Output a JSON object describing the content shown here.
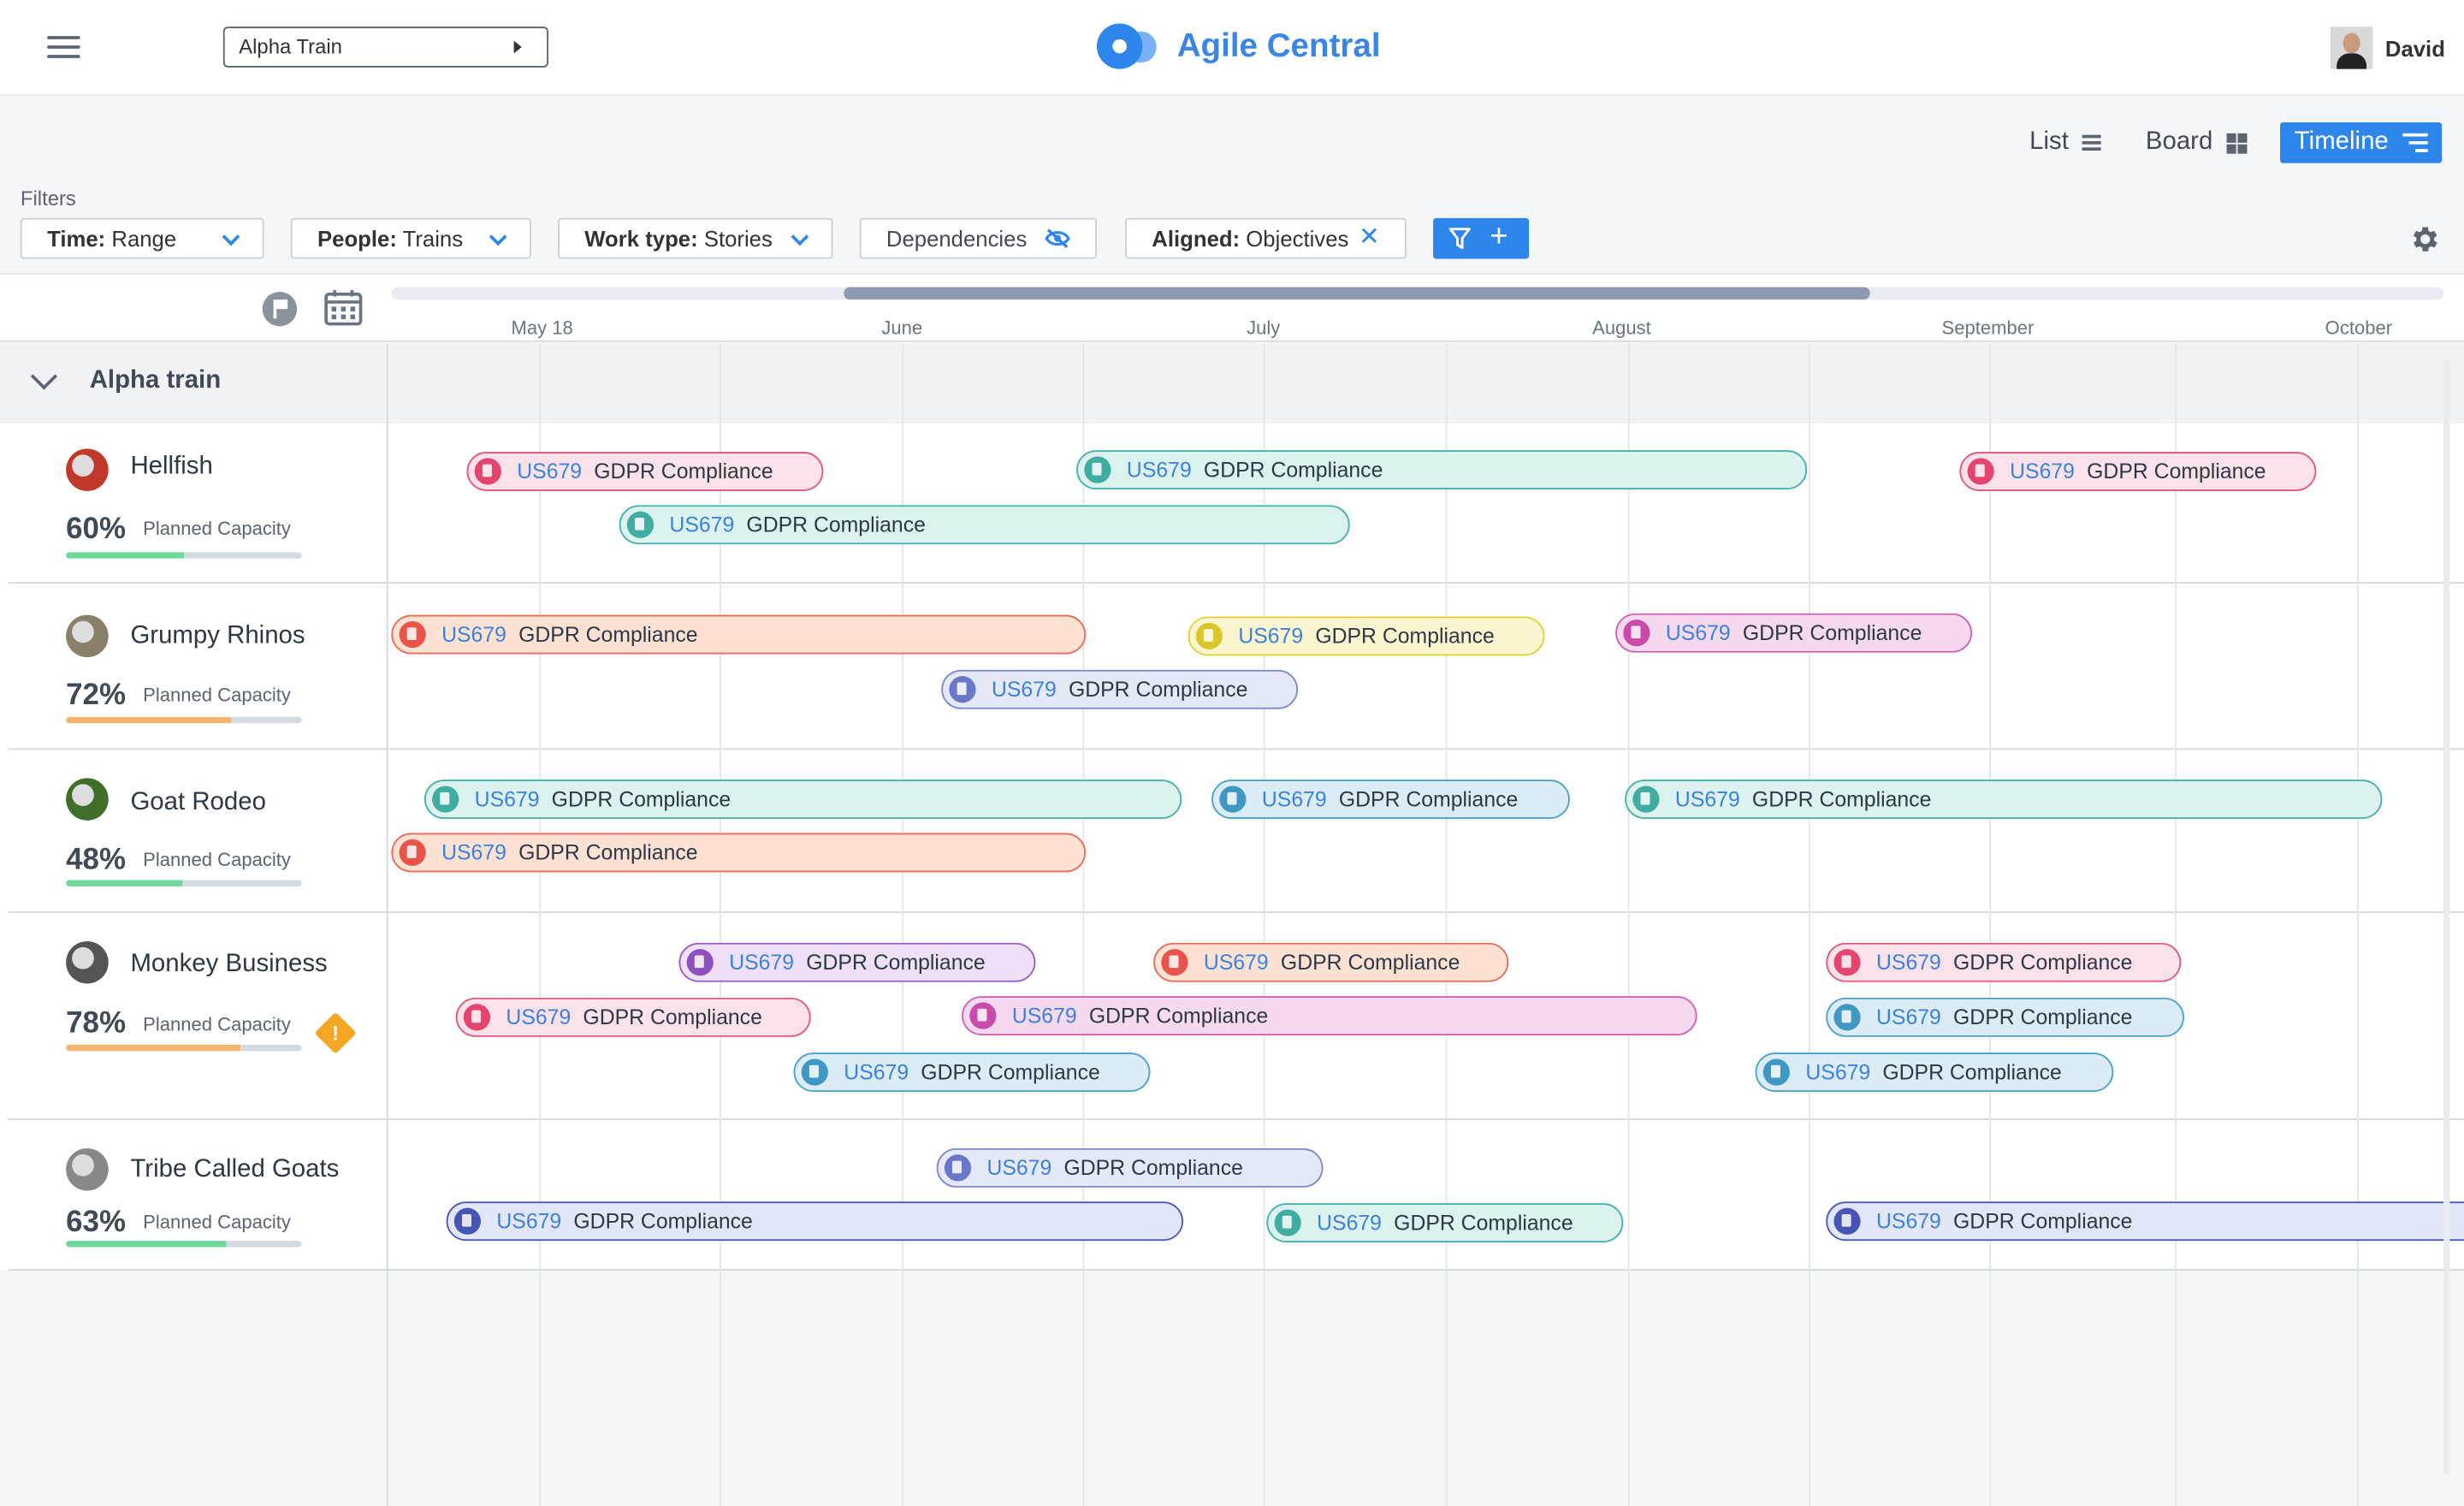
{
  "header": {
    "train_select": "Alpha Train",
    "brand": "Agile Central",
    "user_name": "David"
  },
  "views": {
    "list": "List",
    "board": "Board",
    "timeline": "Timeline",
    "active": "Timeline"
  },
  "filters": {
    "label": "Filters",
    "time_key": "Time:",
    "time_value": "Range",
    "people_key": "People:",
    "people_value": "Trains",
    "worktype_key": "Work type:",
    "worktype_value": "Stories",
    "dependencies": "Dependencies",
    "aligned_key": "Aligned:",
    "aligned_value": "Objectives"
  },
  "scale": {
    "months": [
      "May 18",
      "June",
      "July",
      "August",
      "September",
      "October"
    ]
  },
  "group": {
    "title": "Alpha train"
  },
  "colors": {
    "pink": {
      "bg": "#fbe1e9",
      "border": "#e3587c",
      "dot": "#e3456f"
    },
    "teal": {
      "bg": "#dcf2ef",
      "border": "#45b3a5",
      "dot": "#3fada0"
    },
    "orange": {
      "bg": "#fde2d4",
      "border": "#ec6a5a",
      "dot": "#e8534a"
    },
    "yellow": {
      "bg": "#fbf6cf",
      "border": "#e2d23a",
      "dot": "#dcc72a"
    },
    "magenta": {
      "bg": "#f6d8ef",
      "border": "#d161b8",
      "dot": "#c94aab"
    },
    "lavender": {
      "bg": "#e5e8f7",
      "border": "#7d89cf",
      "dot": "#6b77c7"
    },
    "lightblue": {
      "bg": "#dcecf6",
      "border": "#4aa3cc",
      "dot": "#3f98c3"
    },
    "purple": {
      "bg": "#eee1f7",
      "border": "#9b5cc6",
      "dot": "#8e4fbf"
    },
    "indigo": {
      "bg": "#e3e6f6",
      "border": "#4c5bb8",
      "dot": "#4655b2"
    },
    "cap_green": "#6ed89a",
    "cap_orange": "#f6b46d",
    "accent": "#2f86ea"
  },
  "teams": [
    {
      "name": "Hellfish",
      "capacity": "60%",
      "capacity_value": 0.5,
      "capacity_label": "Planned Capacity",
      "cap_color": "green",
      "warning": false,
      "stories": [
        {
          "id": "US679",
          "title": "GDPR Compliance",
          "color": "pink"
        },
        {
          "id": "US679",
          "title": "GDPR Compliance",
          "color": "teal"
        },
        {
          "id": "US679",
          "title": "GDPR Compliance",
          "color": "pink"
        },
        {
          "id": "US679",
          "title": "GDPR Compliance",
          "color": "teal"
        }
      ]
    },
    {
      "name": "Grumpy Rhinos",
      "capacity": "72%",
      "capacity_value": 0.7,
      "capacity_label": "Planned Capacity",
      "cap_color": "orange",
      "warning": false,
      "stories": [
        {
          "id": "US679",
          "title": "GDPR Compliance",
          "color": "orange"
        },
        {
          "id": "US679",
          "title": "GDPR Compliance",
          "color": "yellow"
        },
        {
          "id": "US679",
          "title": "GDPR Compliance",
          "color": "magenta"
        },
        {
          "id": "US679",
          "title": "GDPR Compliance",
          "color": "lavender"
        }
      ]
    },
    {
      "name": "Goat Rodeo",
      "capacity": "48%",
      "capacity_value": 0.49,
      "capacity_label": "Planned Capacity",
      "cap_color": "green",
      "warning": false,
      "stories": [
        {
          "id": "US679",
          "title": "GDPR Compliance",
          "color": "teal"
        },
        {
          "id": "US679",
          "title": "GDPR Compliance",
          "color": "lightblue"
        },
        {
          "id": "US679",
          "title": "GDPR Compliance",
          "color": "teal"
        },
        {
          "id": "US679",
          "title": "GDPR Compliance",
          "color": "orange"
        }
      ]
    },
    {
      "name": "Monkey Business",
      "capacity": "78%",
      "capacity_value": 0.74,
      "capacity_label": "Planned Capacity",
      "cap_color": "orange",
      "warning": true,
      "warning_glyph": "!",
      "stories": [
        {
          "id": "US679",
          "title": "GDPR Compliance",
          "color": "purple"
        },
        {
          "id": "US679",
          "title": "GDPR Compliance",
          "color": "orange"
        },
        {
          "id": "US679",
          "title": "GDPR Compliance",
          "color": "pink"
        },
        {
          "id": "US679",
          "title": "GDPR Compliance",
          "color": "pink"
        },
        {
          "id": "US679",
          "title": "GDPR Compliance",
          "color": "magenta"
        },
        {
          "id": "US679",
          "title": "GDPR Compliance",
          "color": "lightblue"
        },
        {
          "id": "US679",
          "title": "GDPR Compliance",
          "color": "lightblue"
        },
        {
          "id": "US679",
          "title": "GDPR Compliance",
          "color": "lightblue"
        }
      ]
    },
    {
      "name": "Tribe Called Goats",
      "capacity": "63%",
      "capacity_value": 0.68,
      "capacity_label": "Planned Capacity",
      "cap_color": "green",
      "warning": false,
      "stories": [
        {
          "id": "US679",
          "title": "GDPR Compliance",
          "color": "lavender"
        },
        {
          "id": "US679",
          "title": "GDPR Compliance",
          "color": "indigo"
        },
        {
          "id": "US679",
          "title": "GDPR Compliance",
          "color": "teal"
        },
        {
          "id": "US679",
          "title": "GDPR Compliance",
          "color": "indigo"
        }
      ]
    }
  ]
}
